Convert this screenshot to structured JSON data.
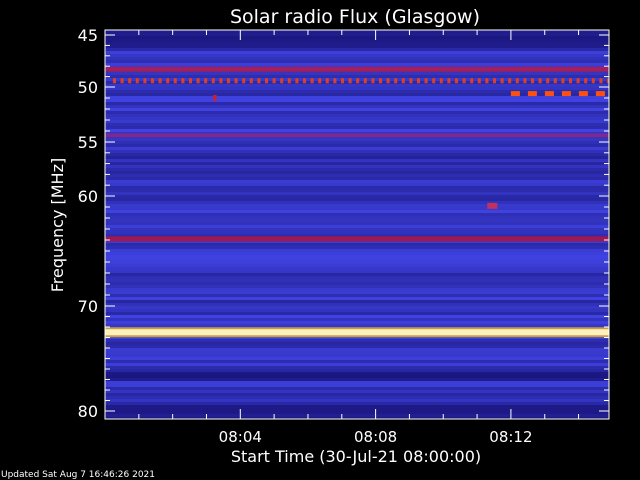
{
  "chart_data": {
    "type": "heatmap",
    "title": "Solar radio Flux (Glasgow)",
    "xlabel": "Start Time (30-Jul-21 08:00:00)",
    "ylabel": "Frequency [MHz]",
    "x_range_minutes": [
      0,
      14.9
    ],
    "y_range_mhz": [
      45,
      80
    ],
    "x_ticks": [
      {
        "minute": 4,
        "label": "08:04"
      },
      {
        "minute": 8,
        "label": "08:08"
      },
      {
        "minute": 12,
        "label": "08:12"
      }
    ],
    "y_ticks": [
      {
        "value": 45,
        "label": "45"
      },
      {
        "value": 50,
        "label": "50"
      },
      {
        "value": 55,
        "label": "55"
      },
      {
        "value": 60,
        "label": "60"
      },
      {
        "value": 70,
        "label": "70"
      },
      {
        "value": 80,
        "label": "80"
      }
    ],
    "colormap": [
      "#000020",
      "#0010a0",
      "#1a2cff",
      "#4a4cff",
      "#8a2070",
      "#c01818",
      "#ff6010",
      "#ffd040",
      "#ffffff"
    ],
    "emission_bands": [
      {
        "freq_mhz": 48.3,
        "intensity": "medium",
        "color": "#a02060"
      },
      {
        "freq_mhz": 49.4,
        "intensity": "pulsed",
        "color": "#e04020"
      },
      {
        "freq_mhz": 54.4,
        "intensity": "low",
        "color": "#7a2a90"
      },
      {
        "freq_mhz": 63.9,
        "intensity": "medium",
        "color": "#a01850"
      },
      {
        "freq_mhz": 72.5,
        "intensity": "high",
        "color": "#fff0c0"
      }
    ],
    "bursts": [
      {
        "start_min": 12.0,
        "end_min": 14.9,
        "freq_mhz": 50.6,
        "color": "#ff5010"
      },
      {
        "start_min": 3.2,
        "end_min": 3.3,
        "freq_mhz": 51.0,
        "color": "#d02020"
      },
      {
        "start_min": 11.3,
        "end_min": 11.6,
        "freq_mhz": 60.9,
        "color": "#c03060"
      }
    ]
  },
  "footer": {
    "updated": "Updated Sat Aug  7 16:46:26 2021"
  }
}
